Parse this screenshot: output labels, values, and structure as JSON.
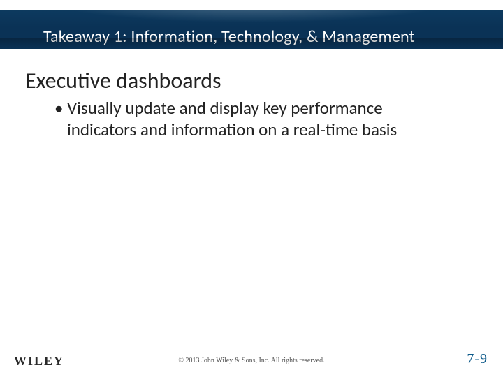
{
  "header": {
    "title": "Takeaway 1: Information, Technology, & Management"
  },
  "content": {
    "heading": "Executive dashboards",
    "bullets": [
      "Visually update and display key performance indicators and information on a real-time basis"
    ]
  },
  "footer": {
    "logo": "WILEY",
    "copyright": "© 2013 John Wiley & Sons, Inc. All rights reserved.",
    "page_number": "7-9"
  }
}
